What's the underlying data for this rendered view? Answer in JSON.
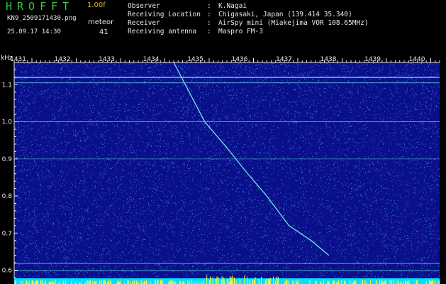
{
  "header": {
    "brand": "HROFFT",
    "version": "1.00f",
    "filename": "KN9_2509171430.png",
    "mode_label": "meteor",
    "datetime": "25.09.17 14:30",
    "count": "41"
  },
  "info": [
    {
      "label": "Observer",
      "value": "K.Nagai"
    },
    {
      "label": "Receiving Location",
      "value": "Chigasaki, Japan (139.414 35.340)"
    },
    {
      "label": "Receiver",
      "value": "AirSpy mini (Miakejima VOR 108.65MHz)"
    },
    {
      "label": "Receiving antenna",
      "value": "Maspro FM-3"
    }
  ],
  "colors": {
    "background": "#0a0f8a",
    "noise": "#4a9aff",
    "trace": "#6ee6e6",
    "bottom_band": "#00e0ff",
    "bottom_spikes": "#ffff30"
  },
  "chart_data": {
    "type": "heatmap",
    "unit_label": "kHz",
    "x_ticks": [
      "1431",
      "1432",
      "1433",
      "1434",
      "1435",
      "1436",
      "1437",
      "1438",
      "1439",
      "1440"
    ],
    "y_ticks": [
      "1.1",
      "1.0",
      "0.9",
      "0.8",
      "0.7",
      "0.6"
    ],
    "x_range": [
      1430.6,
      1440.2
    ],
    "y_range": [
      0.578,
      1.16
    ],
    "horizontal_lines": [
      1.12,
      1.105,
      1.0,
      0.9,
      0.618,
      0.598
    ],
    "meteor_trace": [
      {
        "x": 1434.2,
        "y": 1.16
      },
      {
        "x": 1434.55,
        "y": 1.08
      },
      {
        "x": 1434.9,
        "y": 1.0
      },
      {
        "x": 1435.4,
        "y": 0.93
      },
      {
        "x": 1435.8,
        "y": 0.87
      },
      {
        "x": 1436.3,
        "y": 0.8
      },
      {
        "x": 1436.8,
        "y": 0.72
      },
      {
        "x": 1437.3,
        "y": 0.68
      },
      {
        "x": 1437.7,
        "y": 0.64
      }
    ]
  }
}
